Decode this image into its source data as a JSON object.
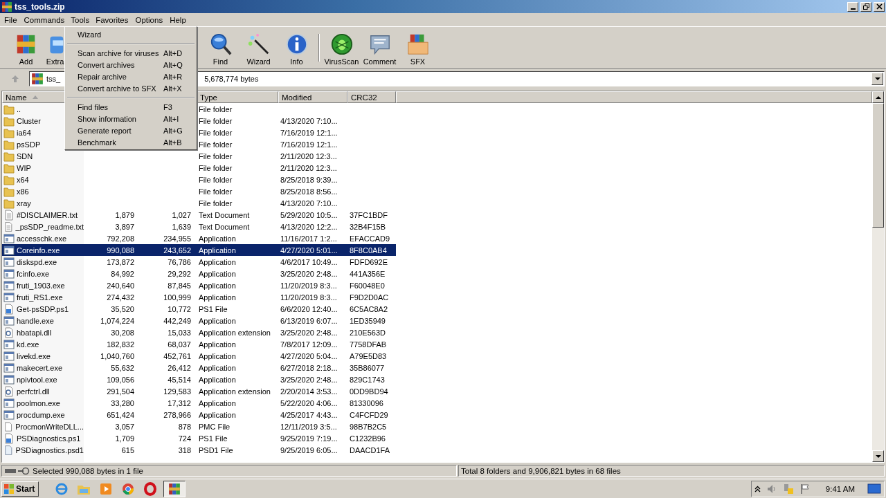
{
  "window": {
    "title": "tss_tools.zip"
  },
  "menu_bar": [
    {
      "label": "File",
      "selected": false
    },
    {
      "label": "Commands",
      "selected": false
    },
    {
      "label": "Tools",
      "selected": true
    },
    {
      "label": "Favorites",
      "selected": false
    },
    {
      "label": "Options",
      "selected": false
    },
    {
      "label": "Help",
      "selected": false
    }
  ],
  "toolbar": [
    {
      "label": "Add",
      "kind": "add"
    },
    {
      "label": "Extra",
      "kind": "extract"
    },
    {
      "label": "Find",
      "kind": "find"
    },
    {
      "label": "Wizard",
      "kind": "wizard"
    },
    {
      "label": "Info",
      "kind": "info"
    },
    {
      "label": "VirusScan",
      "kind": "virus"
    },
    {
      "label": "Comment",
      "kind": "comment"
    },
    {
      "label": "SFX",
      "kind": "sfx"
    }
  ],
  "address": {
    "value_start": "tss_",
    "value_end": "5,678,774 bytes"
  },
  "table": {
    "columns": [
      {
        "label": "Name",
        "sorted": true
      },
      {},
      {},
      {
        "label": "Type"
      },
      {
        "label": "Modified"
      },
      {
        "label": "CRC32"
      }
    ],
    "rows": [
      {
        "kind": "folder",
        "name": "..",
        "type": "File folder",
        "selected": false
      },
      {
        "kind": "folder",
        "name": "Cluster",
        "type": "File folder",
        "modified": "4/13/2020 7:10...",
        "selected": false
      },
      {
        "kind": "folder",
        "name": "ia64",
        "type": "File folder",
        "modified": "7/16/2019 12:1...",
        "selected": false
      },
      {
        "kind": "folder",
        "name": "psSDP",
        "type": "File folder",
        "modified": "7/16/2019 12:1...",
        "selected": false
      },
      {
        "kind": "folder",
        "name": "SDN",
        "type": "File folder",
        "modified": "2/11/2020 12:3...",
        "selected": false
      },
      {
        "kind": "folder",
        "name": "WIP",
        "type": "File folder",
        "modified": "2/11/2020 12:3...",
        "selected": false
      },
      {
        "kind": "folder",
        "name": "x64",
        "type": "File folder",
        "modified": "8/25/2018 9:39...",
        "selected": false
      },
      {
        "kind": "folder",
        "name": "x86",
        "type": "File folder",
        "modified": "8/25/2018 8:56...",
        "selected": false
      },
      {
        "kind": "folder",
        "name": "xray",
        "type": "File folder",
        "modified": "4/13/2020 7:10...",
        "selected": false
      },
      {
        "kind": "text",
        "name": "#DISCLAIMER.txt",
        "size": "1,879",
        "packed": "1,027",
        "type": "Text Document",
        "modified": "5/29/2020 10:5...",
        "crc": "37FC1BDF",
        "selected": false
      },
      {
        "kind": "text",
        "name": "_psSDP_readme.txt",
        "size": "3,897",
        "packed": "1,639",
        "type": "Text Document",
        "modified": "4/13/2020 12:2...",
        "crc": "32B4F15B",
        "selected": false
      },
      {
        "kind": "app",
        "name": "accesschk.exe",
        "size": "792,208",
        "packed": "234,955",
        "type": "Application",
        "modified": "11/16/2017 1:2...",
        "crc": "EFACCAD9",
        "selected": false
      },
      {
        "kind": "app",
        "name": "Coreinfo.exe",
        "size": "990,088",
        "packed": "243,652",
        "type": "Application",
        "modified": "4/27/2020 5:01...",
        "crc": "8F8C0AB4",
        "selected": true
      },
      {
        "kind": "app",
        "name": "diskspd.exe",
        "size": "173,872",
        "packed": "76,786",
        "type": "Application",
        "modified": "4/6/2017 10:49...",
        "crc": "FDFD692E",
        "selected": false
      },
      {
        "kind": "app",
        "name": "fcinfo.exe",
        "size": "84,992",
        "packed": "29,292",
        "type": "Application",
        "modified": "3/25/2020 2:48...",
        "crc": "441A356E",
        "selected": false
      },
      {
        "kind": "app",
        "name": "fruti_1903.exe",
        "size": "240,640",
        "packed": "87,845",
        "type": "Application",
        "modified": "11/20/2019 8:3...",
        "crc": "F60048E0",
        "selected": false
      },
      {
        "kind": "app",
        "name": "fruti_RS1.exe",
        "size": "274,432",
        "packed": "100,999",
        "type": "Application",
        "modified": "11/20/2019 8:3...",
        "crc": "F9D2D0AC",
        "selected": false
      },
      {
        "kind": "script",
        "name": "Get-psSDP.ps1",
        "size": "35,520",
        "packed": "10,772",
        "type": "PS1 File",
        "modified": "6/6/2020 12:40...",
        "crc": "6C5AC8A2",
        "selected": false
      },
      {
        "kind": "app",
        "name": "handle.exe",
        "size": "1,074,224",
        "packed": "442,249",
        "type": "Application",
        "modified": "6/13/2019 6:07...",
        "crc": "1ED35949",
        "selected": false
      },
      {
        "kind": "dll",
        "name": "hbatapi.dll",
        "size": "30,208",
        "packed": "15,033",
        "type": "Application extension",
        "modified": "3/25/2020 2:48...",
        "crc": "210E563D",
        "selected": false
      },
      {
        "kind": "app",
        "name": "kd.exe",
        "size": "182,832",
        "packed": "68,037",
        "type": "Application",
        "modified": "7/8/2017 12:09...",
        "crc": "7758DFAB",
        "selected": false
      },
      {
        "kind": "app",
        "name": "livekd.exe",
        "size": "1,040,760",
        "packed": "452,761",
        "type": "Application",
        "modified": "4/27/2020 5:04...",
        "crc": "A79E5D83",
        "selected": false
      },
      {
        "kind": "app",
        "name": "makecert.exe",
        "size": "55,632",
        "packed": "26,412",
        "type": "Application",
        "modified": "6/27/2018 2:18...",
        "crc": "35B86077",
        "selected": false
      },
      {
        "kind": "app",
        "name": "npivtool.exe",
        "size": "109,056",
        "packed": "45,514",
        "type": "Application",
        "modified": "3/25/2020 2:48...",
        "crc": "829C1743",
        "selected": false
      },
      {
        "kind": "dll",
        "name": "perfctrl.dll",
        "size": "291,504",
        "packed": "129,583",
        "type": "Application extension",
        "modified": "2/20/2014 3:53...",
        "crc": "0DD9BD94",
        "selected": false
      },
      {
        "kind": "app",
        "name": "poolmon.exe",
        "size": "33,280",
        "packed": "17,312",
        "type": "Application",
        "modified": "5/22/2020 4:06...",
        "crc": "81330096",
        "selected": false
      },
      {
        "kind": "app",
        "name": "procdump.exe",
        "size": "651,424",
        "packed": "278,966",
        "type": "Application",
        "modified": "4/25/2017 4:43...",
        "crc": "C4FCFD29",
        "selected": false
      },
      {
        "kind": "file",
        "name": "ProcmonWriteDLL...",
        "size": "3,057",
        "packed": "878",
        "type": "PMC File",
        "modified": "12/11/2019 3:5...",
        "crc": "98B7B2C5",
        "selected": false
      },
      {
        "kind": "script",
        "name": "PSDiagnostics.ps1",
        "size": "1,709",
        "packed": "724",
        "type": "PS1 File",
        "modified": "9/25/2019 7:19...",
        "crc": "C1232B96",
        "selected": false
      },
      {
        "kind": "data",
        "name": "PSDiagnostics.psd1",
        "size": "615",
        "packed": "318",
        "type": "PSD1 File",
        "modified": "9/25/2019 6:05...",
        "crc": "DAACD1FA",
        "selected": false
      }
    ]
  },
  "tools_menu": [
    {
      "kind": "item",
      "label": "Wizard"
    },
    {
      "kind": "separator"
    },
    {
      "kind": "item",
      "label": "Scan archive for viruses",
      "shortcut": "Alt+D"
    },
    {
      "kind": "item",
      "label": "Convert archives",
      "shortcut": "Alt+Q"
    },
    {
      "kind": "item",
      "label": "Repair archive",
      "shortcut": "Alt+R"
    },
    {
      "kind": "item",
      "label": "Convert archive to SFX",
      "shortcut": "Alt+X"
    },
    {
      "kind": "separator"
    },
    {
      "kind": "item",
      "label": "Find files",
      "shortcut": "F3"
    },
    {
      "kind": "item",
      "label": "Show information",
      "shortcut": "Alt+I"
    },
    {
      "kind": "item",
      "label": "Generate report",
      "shortcut": "Alt+G"
    },
    {
      "kind": "item",
      "label": "Benchmark",
      "shortcut": "Alt+B"
    }
  ],
  "status_bar": {
    "selection": "Selected 990,088 bytes in 1 file",
    "total": "Total 8 folders and 9,906,821 bytes in 68 files"
  },
  "taskbar": {
    "start": "Start",
    "clock": "9:41 AM"
  }
}
